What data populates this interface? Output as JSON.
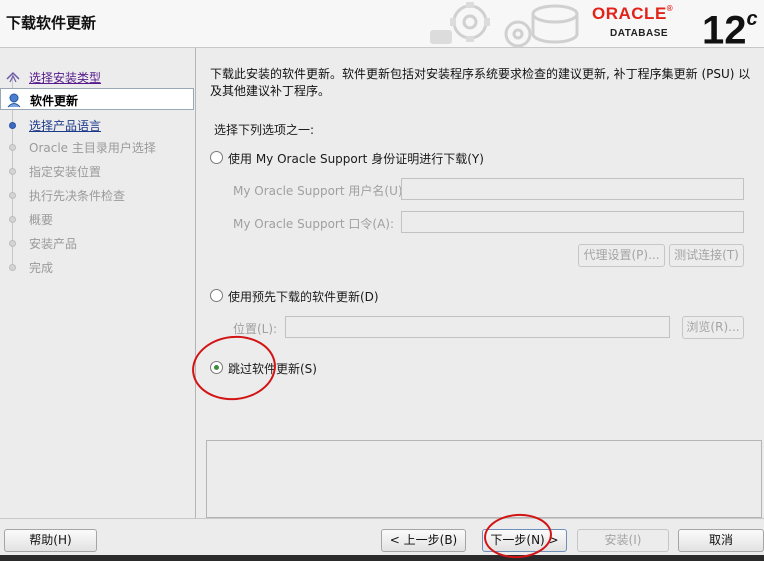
{
  "window": {
    "title": "下载软件更新"
  },
  "brand": {
    "oracle": "ORACLE",
    "database": "DATABASE",
    "version": "12",
    "version_suffix": "c"
  },
  "nav": {
    "items": [
      {
        "label": "选择安装类型",
        "state": "done"
      },
      {
        "label": "软件更新",
        "state": "active"
      },
      {
        "label": "选择产品语言",
        "state": "link"
      },
      {
        "label": "Oracle 主目录用户选择",
        "state": "disabled"
      },
      {
        "label": "指定安装位置",
        "state": "disabled"
      },
      {
        "label": "执行先决条件检查",
        "state": "disabled"
      },
      {
        "label": "概要",
        "state": "disabled"
      },
      {
        "label": "安装产品",
        "state": "disabled"
      },
      {
        "label": "完成",
        "state": "disabled"
      }
    ]
  },
  "main": {
    "description": "下载此安装的软件更新。软件更新包括对安装程序系统要求检查的建议更新, 补丁程序集更新 (PSU) 以及其他建议补丁程序。",
    "choose_label": "选择下列选项之一:",
    "option_mos": {
      "label": "使用 My Oracle Support 身份证明进行下载(Y)",
      "checked": false
    },
    "username_label": "My Oracle Support 用户名(U):",
    "username_value": "",
    "password_label": "My Oracle Support 口令(A):",
    "password_value": "",
    "proxy_button": "代理设置(P)...",
    "test_button": "测试连接(T)",
    "option_predownloaded": {
      "label": "使用预先下载的软件更新(D)",
      "checked": false
    },
    "location_label": "位置(L):",
    "location_value": "",
    "browse_button": "浏览(R)...",
    "option_skip": {
      "label": "跳过软件更新(S)",
      "checked": true
    }
  },
  "footer": {
    "help": "帮助(H)",
    "back": "< 上一步(B)",
    "next": "下一步(N) >",
    "install": "安装(I)",
    "cancel": "取消"
  },
  "colors": {
    "oracle_red": "#e2231a",
    "annotation_red": "#d21414",
    "radio_green": "#3a8f3a"
  }
}
